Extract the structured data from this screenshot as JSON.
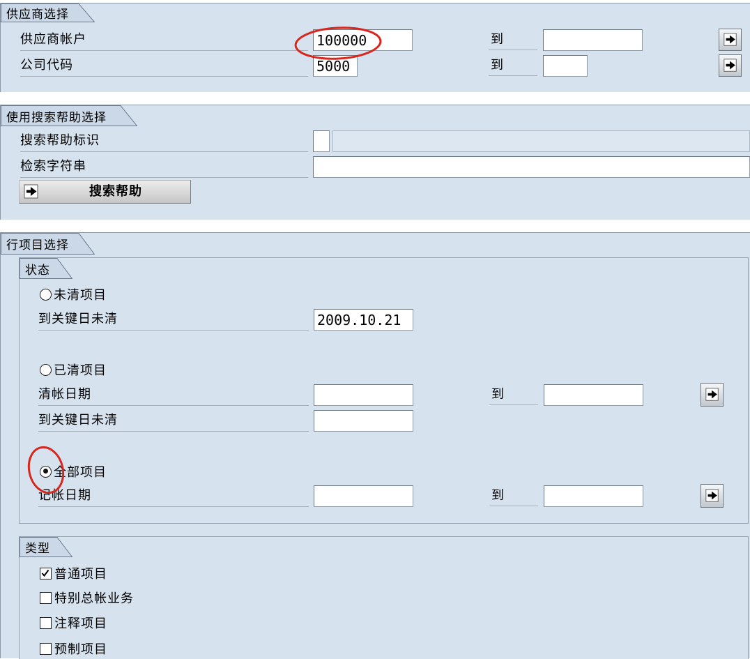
{
  "colors": {
    "panel_bg": "#d6e2ee",
    "tab_fill": "#cad8e7",
    "tab_stroke": "#6a7a8c",
    "disabled_field": "#dde7f2",
    "annotation": "#d8261d"
  },
  "icons": {
    "range_button": "arrow-right-icon",
    "search_help_button": "arrow-right-icon",
    "annotation": "red-highlight-circle"
  },
  "vendor_selection": {
    "title": "供应商选择",
    "vendor_account": {
      "label": "供应商帐户",
      "from": "100000",
      "to_label": "到",
      "to": ""
    },
    "company_code": {
      "label": "公司代码",
      "from": "5000",
      "to_label": "到",
      "to": ""
    }
  },
  "search_help_selection": {
    "title": "使用搜索帮助选择",
    "search_help_id": {
      "label": "搜索帮助标识",
      "value": "",
      "description": ""
    },
    "search_string": {
      "label": "检索字符串",
      "value": ""
    },
    "button_label": "搜索帮助"
  },
  "line_item_selection": {
    "title": "行项目选择",
    "status": {
      "title": "状态",
      "open_items": {
        "label": "未清项目",
        "selected": false
      },
      "open_key_date": {
        "label": "到关键日未清",
        "value": "2009.10.21"
      },
      "cleared_items": {
        "label": "已清项目",
        "selected": false
      },
      "clearing_date": {
        "label": "清帐日期",
        "from": "",
        "to_label": "到",
        "to": ""
      },
      "cleared_open_key_date": {
        "label": "到关键日未清",
        "value": ""
      },
      "all_items": {
        "label": "全部项目",
        "selected": true
      },
      "posting_date": {
        "label": "记帐日期",
        "from": "",
        "to_label": "到",
        "to": ""
      }
    },
    "type": {
      "title": "类型",
      "items": [
        {
          "label": "普通项目",
          "checked": true
        },
        {
          "label": "特别总帐业务",
          "checked": false
        },
        {
          "label": "注释项目",
          "checked": false
        },
        {
          "label": "预制项目",
          "checked": false
        }
      ]
    }
  }
}
